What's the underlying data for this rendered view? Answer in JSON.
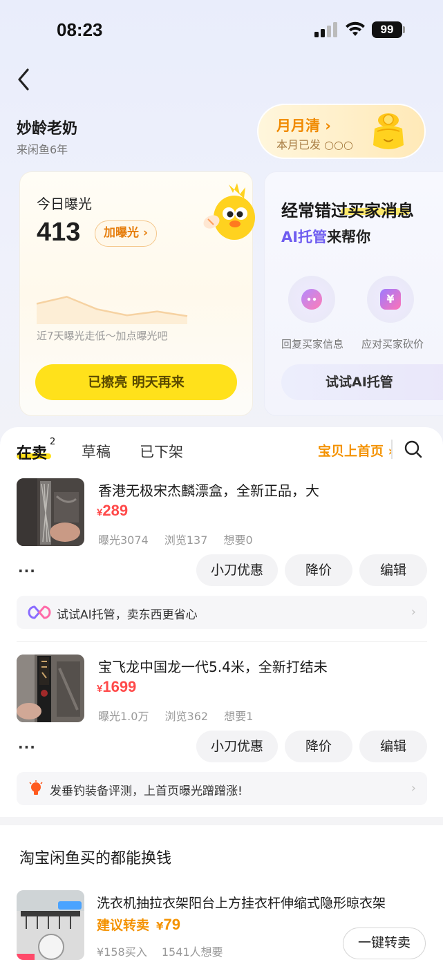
{
  "status_bar": {
    "time": "08:23",
    "battery": "99"
  },
  "seller": {
    "name": "妙龄老奶",
    "tenure": "来闲鱼6年"
  },
  "monthly": {
    "title": "月月清 ›",
    "subtitle": "本月已发 ○○○"
  },
  "exposure": {
    "title": "今日曝光",
    "value": "413",
    "boost_label": "加曝光 ›",
    "trend": [
      0.42,
      0.6,
      0.28,
      0.12,
      0.22,
      0.1
    ],
    "hint": "近7天曝光走低～加点曝光吧",
    "action_label": "已擦亮 明天再来"
  },
  "ai_card": {
    "title": "经常错过买家消息",
    "brand": "AI托管",
    "subtitle_rest": "来帮你",
    "feature_1": "回复买家信息",
    "feature_2": "应对买家砍价",
    "button_label": "试试AI托管"
  },
  "tabs": {
    "selling": "在卖",
    "selling_count": "2",
    "drafts": "草稿",
    "offline": "已下架",
    "promo": "宝贝上首页 ›"
  },
  "items": [
    {
      "title": "香港无极宋杰麟漂盒，全新正品，大",
      "currency": "¥",
      "price": "289",
      "stats": [
        "曝光3074",
        "浏览137",
        "想要0"
      ],
      "more": "···",
      "actions": [
        "小刀优惠",
        "降价",
        "编辑"
      ],
      "tip": "试试AI托管，卖东西更省心",
      "tip_arrow": "›"
    },
    {
      "title": "宝飞龙中国龙一代5.4米，全新打结未",
      "currency": "¥",
      "price": "1699",
      "stats": [
        "曝光1.0万",
        "浏览362",
        "想要1"
      ],
      "more": "···",
      "actions": [
        "小刀优惠",
        "降价",
        "编辑"
      ],
      "tip": "发垂钓装备评测，上首页曝光蹭蹭涨!",
      "tip_arrow": "›"
    }
  ],
  "recommend": {
    "section_title": "淘宝闲鱼买的都能换钱",
    "title": "洗衣机抽拉衣架阳台上方挂衣杆伸缩式隐形晾衣架",
    "resale_label": "建议转卖",
    "currency": "¥",
    "price": "79",
    "stats": [
      "¥158买入",
      "1541人想要"
    ],
    "button_label": "一键转卖"
  },
  "colors": {
    "accent_yellow": "#ffe11b",
    "price_red": "#ff4a4a",
    "promo_orange": "#f49200",
    "ai_purple": "#6e5cf0"
  }
}
